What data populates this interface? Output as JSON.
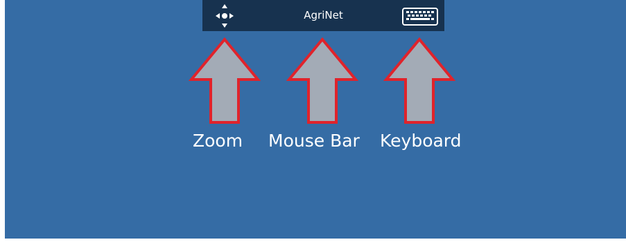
{
  "app": {
    "title": "AgriNet"
  },
  "toolbar": {
    "left_icon": "zoom-move-icon",
    "right_icon": "keyboard-icon"
  },
  "callouts": [
    {
      "label": "Zoom"
    },
    {
      "label": "Mouse Bar"
    },
    {
      "label": "Keyboard"
    }
  ],
  "colors": {
    "background": "#356ca5",
    "toolbar": "#17324f",
    "arrow_fill": "#a3abb6",
    "arrow_outline": "#e0232b",
    "text": "#ffffff"
  }
}
